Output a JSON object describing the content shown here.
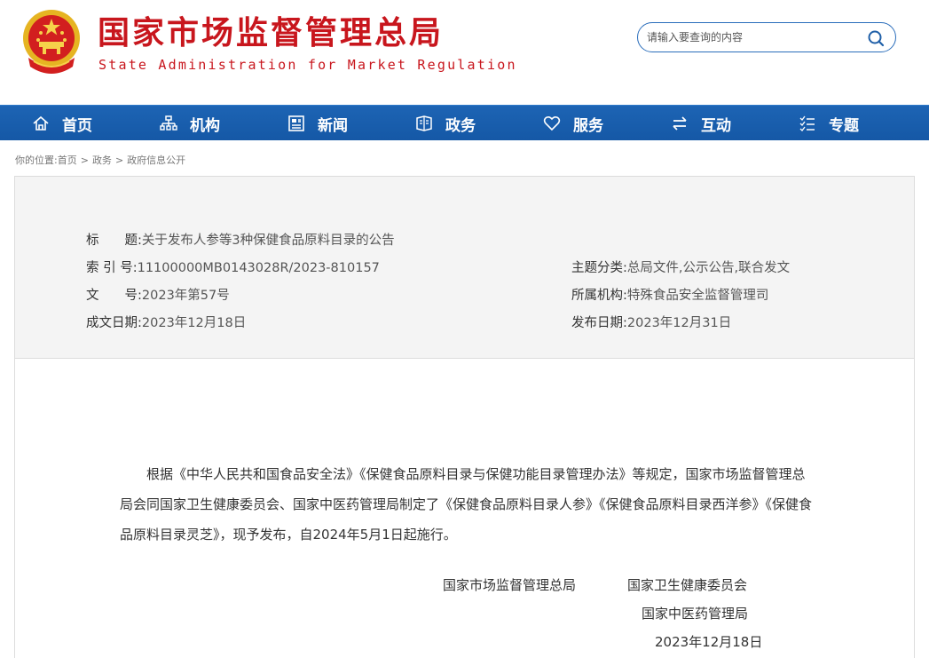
{
  "header": {
    "title": "国家市场监督管理总局",
    "subtitle": "State Administration for Market Regulation",
    "search_placeholder": "请输入要查询的内容"
  },
  "nav": {
    "items": [
      {
        "label": "首页",
        "icon": "home-icon"
      },
      {
        "label": "机构",
        "icon": "org-chart-icon"
      },
      {
        "label": "新闻",
        "icon": "news-icon"
      },
      {
        "label": "政务",
        "icon": "government-icon"
      },
      {
        "label": "服务",
        "icon": "heart-icon"
      },
      {
        "label": "互动",
        "icon": "exchange-icon"
      },
      {
        "label": "专题",
        "icon": "list-icon"
      }
    ]
  },
  "breadcrumb": {
    "prefix": "你的位置:",
    "items": [
      "首页",
      "政务",
      "政府信息公开"
    ],
    "separator": ">"
  },
  "meta": {
    "title_label": "标　　题:",
    "title_value": "关于发布人参等3种保健食品原料目录的公告",
    "index_label": "索 引 号:",
    "index_value": "11100000MB0143028R/2023-810157",
    "category_label": "主题分类:",
    "category_value": "总局文件,公示公告,联合发文",
    "doc_no_label": "文　　号:",
    "doc_no_value": "2023年第57号",
    "org_label": "所属机构:",
    "org_value": "特殊食品安全监督管理司",
    "written_date_label": "成文日期:",
    "written_date_value": "2023年12月18日",
    "publish_date_label": "发布日期:",
    "publish_date_value": "2023年12月31日"
  },
  "article": {
    "body": "根据《中华人民共和国食品安全法》《保健食品原料目录与保健功能目录管理办法》等规定，国家市场监督管理总局会同国家卫生健康委员会、国家中医药管理局制定了《保健食品原料目录人参》《保健食品原料目录西洋参》《保健食品原料目录灵芝》，现予发布，自2024年5月1日起施行。",
    "signers": [
      "国家市场监督管理总局",
      "国家卫生健康委员会",
      "国家中医药管理局"
    ],
    "sign_date": "2023年12月18日"
  },
  "colors": {
    "brand_red": "#c8161d",
    "nav_blue": "#1558a6",
    "emblem_gold": "#f2c231"
  }
}
